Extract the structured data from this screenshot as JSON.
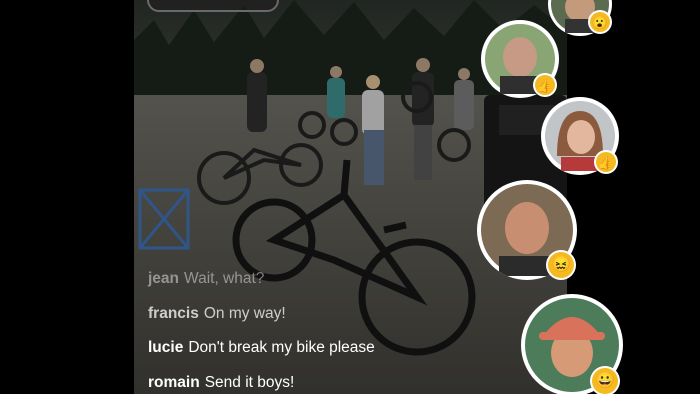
{
  "comments": [
    {
      "user": "jean",
      "message": "Wait, what?"
    },
    {
      "user": "francis",
      "message": "On my way!"
    },
    {
      "user": "lucie",
      "message": "Don't break my bike please"
    },
    {
      "user": "romain",
      "message": "Send it boys!"
    }
  ],
  "reactions": [
    {
      "emoji": "😮",
      "icon": "surprised-emoji-icon"
    },
    {
      "emoji": "👍",
      "icon": "thumbs-up-icon"
    },
    {
      "emoji": "👍",
      "icon": "thumbs-up-icon"
    },
    {
      "emoji": "😖",
      "icon": "frustrated-emoji-icon"
    },
    {
      "emoji": "😀",
      "icon": "grinning-emoji-icon"
    }
  ]
}
